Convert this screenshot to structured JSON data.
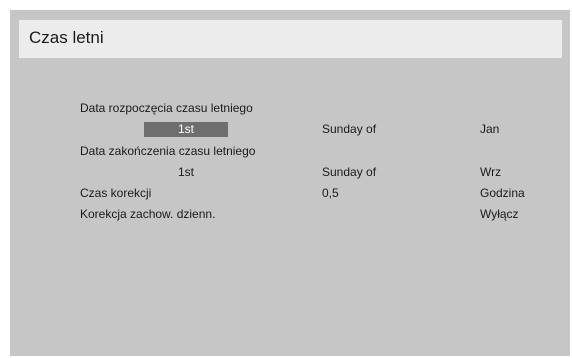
{
  "title": "Czas letni",
  "rows": [
    {
      "label": "Data rozpoczęcia czasu letniego"
    },
    {
      "week": "1st",
      "weekday": "Sunday of",
      "month": "Jan"
    },
    {
      "label": "Data zakończenia czasu letniego"
    },
    {
      "week": "1st",
      "weekday": "Sunday of",
      "month": "Wrz"
    },
    {
      "label": "Czas korekcji",
      "value": "0,5",
      "unit": "Godzina"
    },
    {
      "label": "Korekcja zachow. dzienn.",
      "value": "Wyłącz"
    }
  ],
  "colors": {
    "panel": "#c6c6c6",
    "title_bar": "#ececec",
    "selected": "#6e6e6e"
  }
}
